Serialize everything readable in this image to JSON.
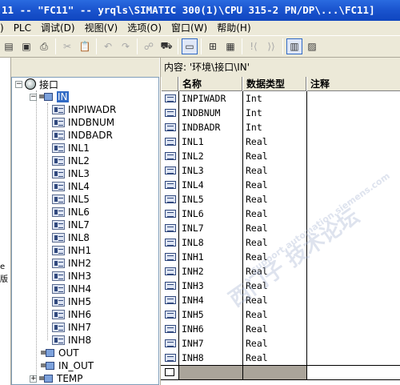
{
  "window": {
    "title": "11 -- \"FC11\" -- yrqls\\SIMATIC 300(1)\\CPU 315-2 PN/DP\\...\\FC11]"
  },
  "menubar": {
    "items": [
      ") ",
      "PLC",
      "调试(D)",
      "视图(V)",
      "选项(O)",
      "窗口(W)",
      "帮助(H)"
    ]
  },
  "toolbar": {
    "icons": [
      "open-icon",
      "save-icon",
      "print-icon",
      "paste-icon",
      "cut-icon",
      "undo-icon",
      "redo-icon",
      "monitor-icon",
      "download-icon",
      "select-icon",
      "network-icon",
      "cpu-icon",
      "breakpoint-icon",
      "overview-icon",
      "detail-icon"
    ]
  },
  "left_edge": {
    "chars": [
      "e",
      "版"
    ]
  },
  "tree": {
    "root": "接口",
    "in_node": "IN",
    "in_children": [
      "INPIWADR",
      "INDBNUM",
      "INDBADR",
      "INL1",
      "INL2",
      "INL3",
      "INL4",
      "INL5",
      "INL6",
      "INL7",
      "INL8",
      "INH1",
      "INH2",
      "INH3",
      "INH4",
      "INH5",
      "INH6",
      "INH7",
      "INH8"
    ],
    "other_nodes": [
      "OUT",
      "IN_OUT",
      "TEMP"
    ]
  },
  "content": {
    "path_label": "内容:",
    "path_value": "'环境\\接口\\IN'",
    "columns": [
      "名称",
      "数据类型",
      "注释"
    ],
    "rows": [
      {
        "name": "INPIWADR",
        "type": "Int",
        "comment": ""
      },
      {
        "name": "INDBNUM",
        "type": "Int",
        "comment": ""
      },
      {
        "name": "INDBADR",
        "type": "Int",
        "comment": ""
      },
      {
        "name": "INL1",
        "type": "Real",
        "comment": ""
      },
      {
        "name": "INL2",
        "type": "Real",
        "comment": ""
      },
      {
        "name": "INL3",
        "type": "Real",
        "comment": ""
      },
      {
        "name": "INL4",
        "type": "Real",
        "comment": ""
      },
      {
        "name": "INL5",
        "type": "Real",
        "comment": ""
      },
      {
        "name": "INL6",
        "type": "Real",
        "comment": ""
      },
      {
        "name": "INL7",
        "type": "Real",
        "comment": ""
      },
      {
        "name": "INL8",
        "type": "Real",
        "comment": ""
      },
      {
        "name": "INH1",
        "type": "Real",
        "comment": ""
      },
      {
        "name": "INH2",
        "type": "Real",
        "comment": ""
      },
      {
        "name": "INH3",
        "type": "Real",
        "comment": ""
      },
      {
        "name": "INH4",
        "type": "Real",
        "comment": ""
      },
      {
        "name": "INH5",
        "type": "Real",
        "comment": ""
      },
      {
        "name": "INH6",
        "type": "Real",
        "comment": ""
      },
      {
        "name": "INH7",
        "type": "Real",
        "comment": ""
      },
      {
        "name": "INH8",
        "type": "Real",
        "comment": ""
      }
    ]
  },
  "watermark": {
    "lines": [
      "西门子 技术论坛",
      "support.automation.siemens.com"
    ]
  },
  "colors": {
    "titlebar": "#1b55cf",
    "selection": "#316ac5",
    "chrome": "#ece9d8"
  }
}
